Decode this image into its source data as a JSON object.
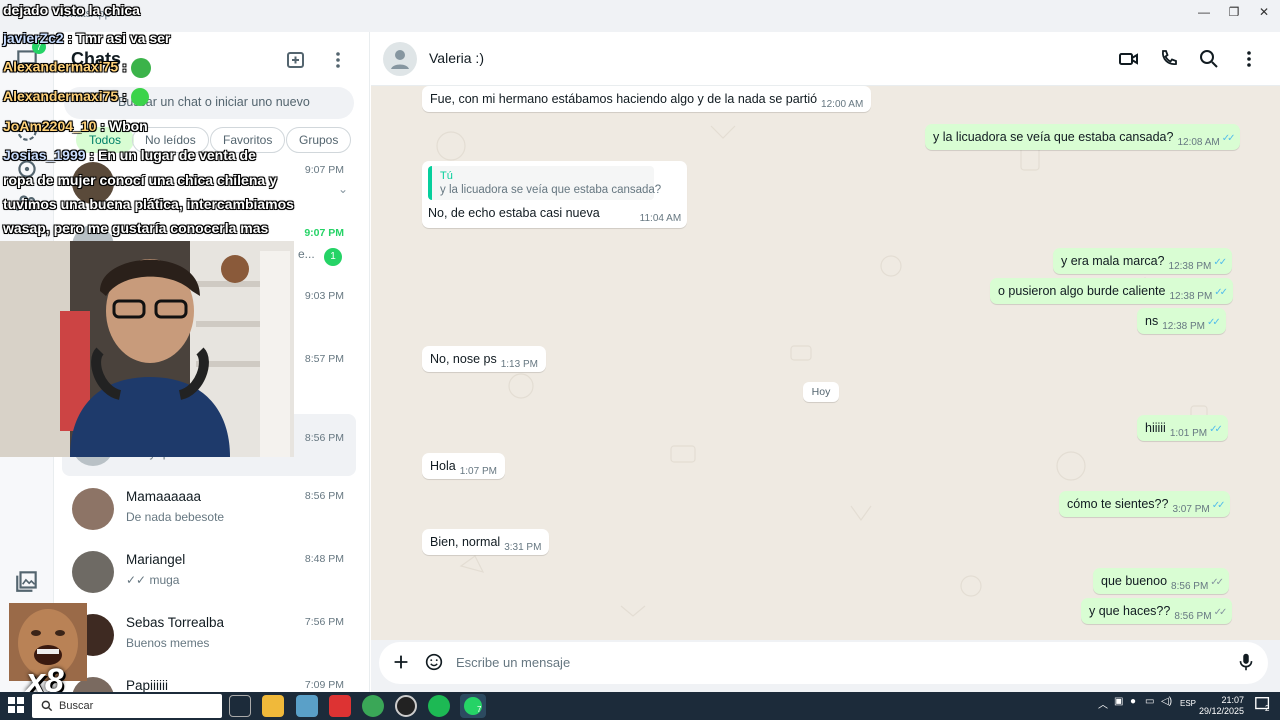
{
  "window": {
    "app_name": "WhatsApp",
    "minimize": "—",
    "maximize": "❐",
    "close": "✕"
  },
  "rail": {
    "badge": "7"
  },
  "sidebar": {
    "title": "Chats",
    "search_placeholder": "Buscar un chat o iniciar uno nuevo",
    "filters": [
      "Todos",
      "No leídos",
      "Favoritos",
      "Grupos"
    ],
    "chats": [
      {
        "name": "",
        "preview": "",
        "time": "9:07 PM",
        "unread": ""
      },
      {
        "name": "",
        "preview": "e...",
        "time": "9:07 PM",
        "unread": "1"
      },
      {
        "name": "",
        "preview": "",
        "time": "9:03 PM",
        "unread": ""
      },
      {
        "name": "",
        "preview": "",
        "time": "8:57 PM",
        "unread": ""
      },
      {
        "name": "",
        "preview": "✓✓ y que haces??",
        "time": "8:56 PM",
        "unread": ""
      },
      {
        "name": "Mamaaaaaa",
        "preview": "De nada bebesote",
        "time": "8:56 PM",
        "unread": ""
      },
      {
        "name": "Mariangel",
        "preview": "✓✓ muga",
        "time": "8:48 PM",
        "unread": ""
      },
      {
        "name": "Sebas Torrealba",
        "preview": "Buenos memes",
        "time": "7:56 PM",
        "unread": ""
      },
      {
        "name": "Papiiiiii",
        "preview": "",
        "time": "7:09 PM",
        "unread": ""
      }
    ]
  },
  "conversation": {
    "contact_name": "Valeria :)",
    "day_separator": "Hoy",
    "composer_placeholder": "Escribe un mensaje",
    "messages": [
      {
        "dir": "in",
        "text": "Fue, con mi hermano estábamos haciendo algo y de la nada se partió",
        "time": "12:00 AM"
      },
      {
        "dir": "out",
        "text": "y la licuadora se veía que estaba cansada?",
        "time": "12:08 AM"
      },
      {
        "dir": "in",
        "quote_author": "Tú",
        "quote_text": "y la licuadora se veía que estaba cansada?",
        "text": "No, de echo estaba casi nueva",
        "time": "11:04 AM"
      },
      {
        "dir": "out",
        "text": "y era mala marca?",
        "time": "12:38 PM"
      },
      {
        "dir": "out",
        "text": "o pusieron algo burde caliente",
        "time": "12:38 PM"
      },
      {
        "dir": "out",
        "text": "ns",
        "time": "12:38 PM"
      },
      {
        "dir": "in",
        "text": "No, nose ps",
        "time": "1:13 PM"
      },
      {
        "dir": "out",
        "text": "hiiiii",
        "time": "1:01 PM"
      },
      {
        "dir": "in",
        "text": "Hola",
        "time": "1:07 PM"
      },
      {
        "dir": "out",
        "text": "cómo te sientes??",
        "time": "3:07 PM"
      },
      {
        "dir": "in",
        "text": "Bien, normal",
        "time": "3:31 PM"
      },
      {
        "dir": "out",
        "text": "que buenoo",
        "time": "8:56 PM"
      },
      {
        "dir": "out",
        "text": "y que haces??",
        "time": "8:56 PM"
      }
    ]
  },
  "overlay": {
    "caption": "dejado visto la chica",
    "lines": [
      {
        "user": "javierZc2",
        "text": ": Tmr asi va ser"
      },
      {
        "user": "Alexandermaxi75",
        "text": ":"
      },
      {
        "user": "Alexandermaxi75",
        "text": ":"
      },
      {
        "user": "JoAm2204_10",
        "text": ": Wbon"
      },
      {
        "user": "Josias_1999",
        "text": ": En un lugar de venta de"
      },
      {
        "user": "",
        "text": "ropa de mujer conocí una chica chilena y"
      },
      {
        "user": "",
        "text": "tuvimos una buena plática, intercambiamos"
      },
      {
        "user": "",
        "text": "wasap, pero me gustaría conocerla mas"
      }
    ],
    "meme_text": "x8"
  },
  "taskbar": {
    "search_placeholder": "Buscar",
    "whatsapp_badge": "7",
    "lang": "ESP",
    "time": "21:07",
    "date": "29/12/2025",
    "notif": "2"
  }
}
